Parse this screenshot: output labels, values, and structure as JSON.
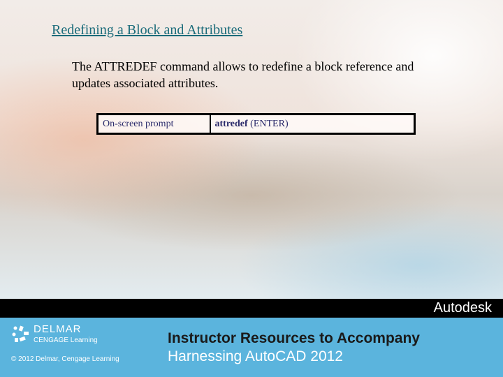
{
  "slide": {
    "title": "Redefining a Block and Attributes",
    "body": "The ATTREDEF command allows to redefine a block reference and updates associated attributes.",
    "table": {
      "label": "On-screen prompt",
      "command": "attredef",
      "suffix": " (ENTER)"
    }
  },
  "footer": {
    "brand": "Autodesk",
    "publisher": "DELMAR",
    "publisher_sub": "CENGAGE Learning",
    "copyright": "© 2012 Delmar, Cengage Learning",
    "heading": "Instructor Resources to Accompany",
    "subheading": "Harnessing AutoCAD 2012",
    "colors": {
      "bar": "#000000",
      "band": "#5bb4dd"
    }
  }
}
